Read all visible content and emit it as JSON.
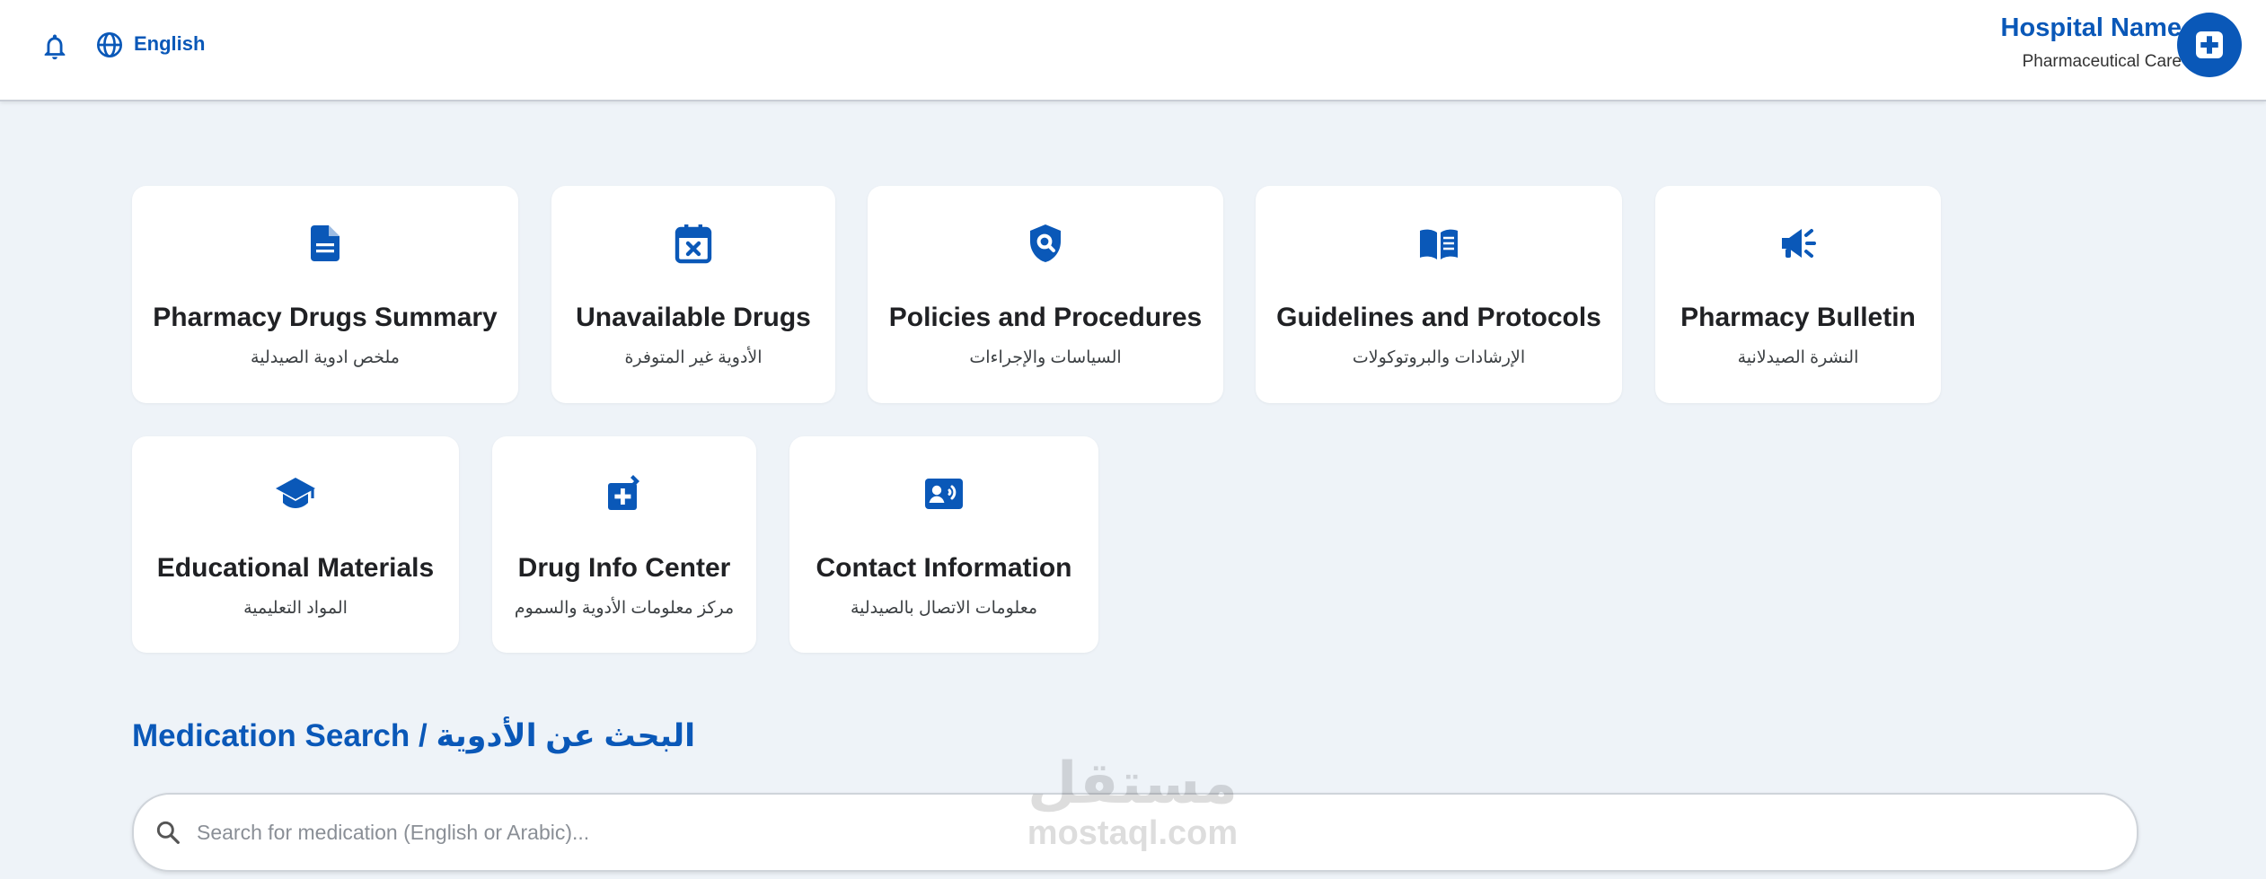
{
  "header": {
    "language": "English",
    "hospital_name": "Hospital Name",
    "hospital_subtitle": "Pharmaceutical Care"
  },
  "cards": [
    {
      "title": "Pharmacy Drugs Summary",
      "subtitle": "ملخص ادوية الصيدلية",
      "icon": "document-icon"
    },
    {
      "title": "Unavailable Drugs",
      "subtitle": "الأدوية غير المتوفرة",
      "icon": "calendar-x-icon"
    },
    {
      "title": "Policies and Procedures",
      "subtitle": "السياسات والإجراءات",
      "icon": "shield-search-icon"
    },
    {
      "title": "Guidelines and Protocols",
      "subtitle": "الإرشادات والبروتوكولات",
      "icon": "open-book-icon"
    },
    {
      "title": "Pharmacy Bulletin",
      "subtitle": "النشرة الصيدلانية",
      "icon": "megaphone-icon"
    },
    {
      "title": "Educational Materials",
      "subtitle": "المواد التعليمية",
      "icon": "graduation-cap-icon"
    },
    {
      "title": "Drug Info Center",
      "subtitle": "مركز معلومات الأدوية والسموم",
      "icon": "mortar-pestle-icon"
    },
    {
      "title": "Contact Information",
      "subtitle": "معلومات الاتصال بالصيدلية",
      "icon": "contact-card-icon"
    }
  ],
  "search": {
    "heading": "Medication Search / البحث عن الأدوية",
    "placeholder": "Search for medication (English or Arabic)..."
  },
  "watermark": {
    "arabic": "مستقل",
    "latin": "mostaql.com"
  },
  "colors": {
    "accent": "#0a58b8",
    "background": "#eef3f8",
    "card": "#ffffff"
  }
}
